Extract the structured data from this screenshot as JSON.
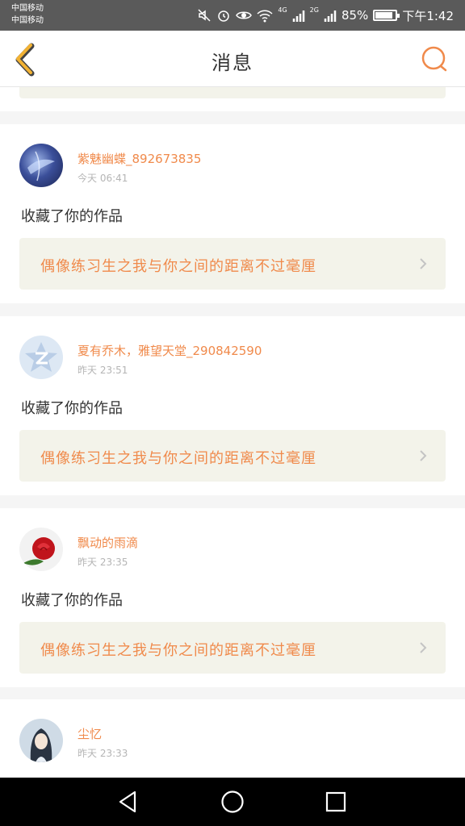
{
  "status_bar": {
    "carrier_1": "中国移动",
    "carrier_2": "中国移动",
    "net_1": "4G",
    "net_2": "2G",
    "battery": "85%",
    "battery_level": 0.85,
    "time": "下午1:42"
  },
  "header": {
    "title": "消息",
    "back_icon": "chevron-left-icon",
    "search_icon": "search-icon"
  },
  "notifications": [
    {
      "user": "紫魅幽蝶_892673835",
      "time": "今天 06:41",
      "action": "收藏了你的作品",
      "work_title": "偶像练习生之我与你之间的距离不过毫厘"
    },
    {
      "user": "夏有乔木，雅望天堂_290842590",
      "time": "昨天 23:51",
      "action": "收藏了你的作品",
      "work_title": "偶像练习生之我与你之间的距离不过毫厘"
    },
    {
      "user": "飘动的雨滴",
      "time": "昨天 23:35",
      "action": "收藏了你的作品",
      "work_title": "偶像练习生之我与你之间的距离不过毫厘"
    },
    {
      "user": "尘忆",
      "time": "昨天 23:33"
    }
  ],
  "colors": {
    "accent": "#f08a4b",
    "back_arrow": "#f2b233",
    "work_bg": "#f3f3ea"
  }
}
